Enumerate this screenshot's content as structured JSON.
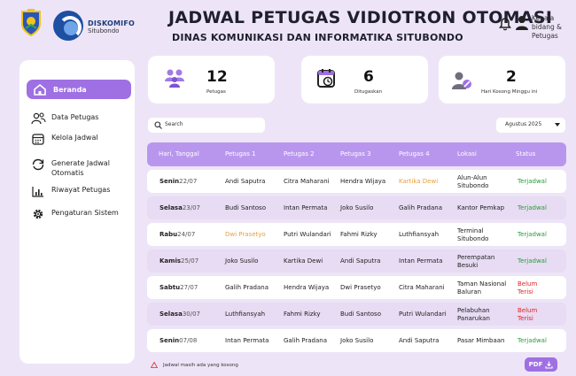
{
  "header": {
    "brand_title": "DISKOMIFO",
    "brand_sub": "Situbondo",
    "title": "JADWAL PETUGAS VIDIOTRON OTOMASI",
    "subtitle": "DINAS KOMUNIKASI DAN INFORMATIKA SITUBONDO",
    "user_label": "Kepala bidang & Petugas"
  },
  "sidebar": {
    "items": [
      {
        "label": "Beranda",
        "icon": "home-icon"
      },
      {
        "label": "Data Petugas",
        "icon": "users-icon"
      },
      {
        "label": "Kelola Jadwal",
        "icon": "calendar-icon"
      },
      {
        "label": "Generate Jadwal Otomatis",
        "icon": "refresh-icon"
      },
      {
        "label": "Riwayat Petugas",
        "icon": "chart-icon"
      },
      {
        "label": "Pengaturan Sistem",
        "icon": "gear-icon"
      }
    ]
  },
  "stats": [
    {
      "value": "12",
      "label": "Petugas"
    },
    {
      "value": "6",
      "label": "Ditugaskan"
    },
    {
      "value": "2",
      "label": "Hari Kosong Minggu ini"
    }
  ],
  "search": {
    "placeholder": "Search"
  },
  "month_select": {
    "value": "Agustus 2025"
  },
  "table": {
    "headers": [
      "Hari, Tanggal",
      "Petugas 1",
      "Petugas 2",
      "Petugas 3",
      "Petugas 4",
      "Lokasi",
      "Status"
    ],
    "rows": [
      {
        "day": "Senin",
        "date": "22/07",
        "p1": "Andi Saputra",
        "p2": "Citra Maharani",
        "p3": "Hendra Wijaya",
        "p4": "Kartika Dewi",
        "lokasi": "Alun-Alun Situbondo",
        "status": "Terjadwal"
      },
      {
        "day": "Selasa",
        "date": "23/07",
        "p1": "Budi Santoso",
        "p2": "Intan Permata",
        "p3": "Joko Susilo",
        "p4": "Galih Pradana",
        "lokasi": "Kantor Pemkap",
        "status": "Terjadwal"
      },
      {
        "day": "Rabu",
        "date": "24/07",
        "p1": "Dwi Prasetyo",
        "p2": "Putri Wulandari",
        "p3": "Fahmi Rizky",
        "p4": "Luthfiansyah",
        "lokasi": "Terminal Situbondo",
        "status": "Terjadwal"
      },
      {
        "day": "Kamis",
        "date": "25/07",
        "p1": "Joko Susilo",
        "p2": "Kartika Dewi",
        "p3": "Andi Saputra",
        "p4": "Intan Permata",
        "lokasi": "Perempatan Besuki",
        "status": "Terjadwal"
      },
      {
        "day": "Sabtu",
        "date": "27/07",
        "p1": "Galih Pradana",
        "p2": "Hendra Wijaya",
        "p3": "Dwi Prasetyo",
        "p4": "Citra Maharani",
        "lokasi": "Taman Nasional Baluran",
        "status": "Belum Terisi"
      },
      {
        "day": "Selasa",
        "date": "30/07",
        "p1": "Luthfiansyah",
        "p2": "Fahmi Rizky",
        "p3": "Budi Santoso",
        "p4": "Putri Wulandari",
        "lokasi": "Pelabuhan Panarukan",
        "status": "Belum Terisi"
      },
      {
        "day": "Senin",
        "date": "07/08",
        "p1": "Intan Permata",
        "p2": "Galih Pradana",
        "p3": "Joko Susilo",
        "p4": "Andi Saputra",
        "lokasi": "Pasar Mimbaan",
        "status": "Terjadwal"
      }
    ]
  },
  "footer": {
    "warning": "Jadwal masih ada yang kosong",
    "pdf_label": "PDF"
  },
  "colors": {
    "accent": "#9e70e3",
    "header_row": "#b996ee",
    "highlight_name": "#e6a13d",
    "status_ok": "#2a9c3b",
    "status_empty": "#e02424"
  }
}
